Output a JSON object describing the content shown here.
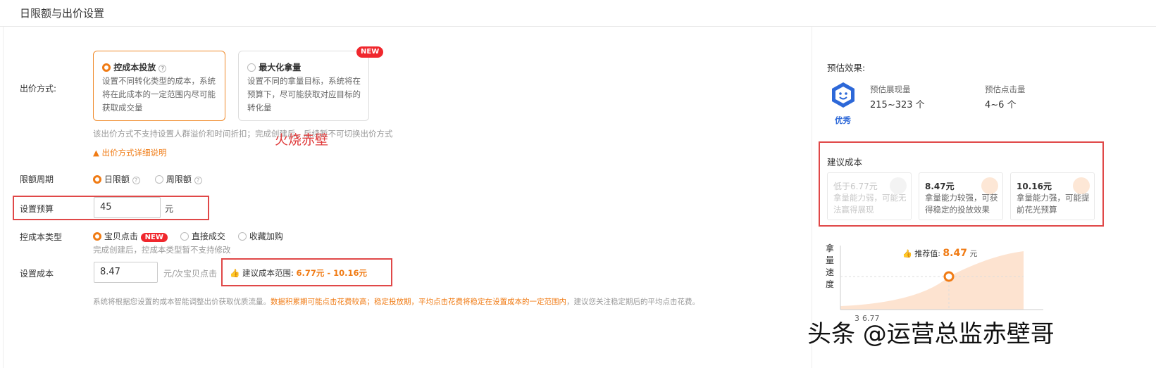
{
  "header": {
    "title": "日限额与出价设置"
  },
  "bid_method": {
    "label": "出价方式:",
    "option1": {
      "title": "控成本投放",
      "desc": "设置不同转化类型的成本，系统将在此成本的一定范围内尽可能获取成交量"
    },
    "option2": {
      "title": "最大化拿量",
      "badge": "NEW",
      "desc": "设置不同的拿量目标，系统将在预算下，尽可能获取对应目标的转化量"
    },
    "note": "该出价方式不支持设置人群溢价和时间折扣；完成创建后，后续暂不可切换出价方式",
    "help_link": "出价方式详细说明"
  },
  "overlay_text": "火烧赤壁",
  "limit_period": {
    "label": "限额周期",
    "opt_daily": "日限额",
    "opt_weekly": "周限额"
  },
  "budget": {
    "label": "设置预算",
    "value": "45",
    "unit": "元"
  },
  "cost_type": {
    "label": "控成本类型",
    "opt1": "宝贝点击",
    "opt1_badge": "NEW",
    "opt2": "直接成交",
    "opt3": "收藏加购",
    "note": "完成创建后，控成本类型暂不支持修改"
  },
  "cost": {
    "label": "设置成本",
    "value": "8.47",
    "unit": "元/次宝贝点击",
    "range_label": "建议成本范围:",
    "range_value": "6.77元 - 10.16元"
  },
  "footer_note": {
    "part1": "系统将根据您设置的成本智能调整出价获取优质流量。",
    "part2": "数据积累期可能点击花费较高；稳定投放期，平均点击花费将稳定在设置成本的一定范围内",
    "part3": "，建议您关注稳定期后的平均点击花费。"
  },
  "estimate": {
    "title": "预估效果:",
    "rating": "优秀",
    "impressions_label": "预估展现量",
    "impressions_value": "215~323 个",
    "clicks_label": "预估点击量",
    "clicks_value": "4~6 个"
  },
  "suggested_cost": {
    "title": "建议成本",
    "cards": [
      {
        "title": "低于6.77元",
        "desc": "拿量能力弱，可能无法赢得展现"
      },
      {
        "title": "8.47元",
        "desc": "拿量能力较强，可获得稳定的投放效果"
      },
      {
        "title": "10.16元",
        "desc": "拿量能力强，可能提前花光预算"
      }
    ]
  },
  "speed_chart": {
    "y_label": "拿量速度",
    "recommended_label": "推荐值:",
    "recommended_value": "8.47",
    "recommended_unit": "元",
    "x_ticks": [
      "3",
      "6.77"
    ],
    "colors": {
      "area": "#fde3d0",
      "marker": "#f07b14"
    }
  },
  "watermark": "头条 @运营总监赤壁哥"
}
